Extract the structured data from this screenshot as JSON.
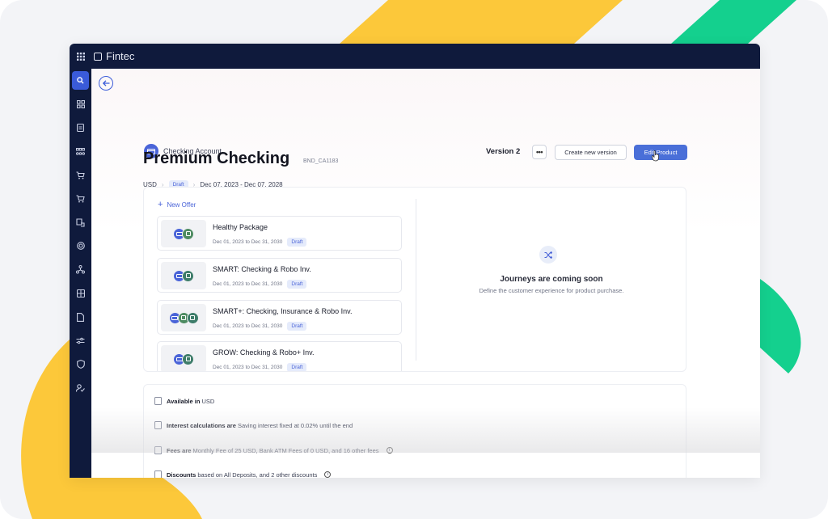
{
  "app": {
    "brand": "Fintec",
    "icons": {
      "grid": "apps-grid-icon",
      "back": "arrow-left-icon",
      "more": "more-horizontal-icon"
    }
  },
  "sidebar": {
    "items": [
      {
        "name": "search-icon",
        "active": true
      },
      {
        "name": "modules-icon"
      },
      {
        "name": "clipboard-icon"
      },
      {
        "name": "bundles-icon"
      },
      {
        "name": "cart-icon"
      },
      {
        "name": "cart-alt-icon"
      },
      {
        "name": "car-icon"
      },
      {
        "name": "target-icon"
      },
      {
        "name": "network-icon"
      },
      {
        "name": "calculator-icon"
      },
      {
        "name": "document-icon"
      },
      {
        "name": "sliders-icon"
      },
      {
        "name": "shield-icon"
      },
      {
        "name": "user-check-icon"
      }
    ]
  },
  "header": {
    "category": "Checking Account",
    "title": "Premium Checking",
    "code": "BND_CA1183",
    "currency": "USD",
    "status": "Draft",
    "date_range": "Dec 07, 2023 - Dec 07, 2028",
    "version_label": "Version 2",
    "more_label": "•••",
    "create_version_label": "Create new version",
    "edit_label": "Edit Product"
  },
  "offers": {
    "new_offer_label": "New Offer",
    "items": [
      {
        "name": "Healthy Package",
        "dates": "Dec 01, 2023 to Dec 31, 2030",
        "status": "Draft",
        "chips": [
          "blue",
          "green"
        ]
      },
      {
        "name": "SMART: Checking & Robo Inv.",
        "dates": "Dec 01, 2023 to Dec 31, 2030",
        "status": "Draft",
        "chips": [
          "blue",
          "teal"
        ]
      },
      {
        "name": "SMART+: Checking, Insurance & Robo Inv.",
        "dates": "Dec 01, 2023 to Dec 31, 2030",
        "status": "Draft",
        "chips": [
          "blue",
          "green",
          "teal"
        ]
      },
      {
        "name": "GROW: Checking & Robo+ Inv.",
        "dates": "Dec 01, 2023 to Dec 31, 2030",
        "status": "Draft",
        "chips": [
          "blue",
          "teal"
        ]
      }
    ]
  },
  "journeys": {
    "title": "Journeys are coming soon",
    "subtitle": "Define the customer experience for product purchase."
  },
  "details": {
    "rows": [
      {
        "bold": "Available in",
        "text": "USD",
        "info": false
      },
      {
        "bold": "Interest calculations are",
        "text": "Saving interest fixed at 0.02% until the end",
        "info": false
      },
      {
        "bold": "Fees are",
        "text": "Monthly Fee of 25 USD, Bank ATM Fees of 0 USD, and 16 other fees",
        "info": true
      },
      {
        "bold": "Discounts",
        "text": "based on All Deposits, and 2 other discounts",
        "info": true
      }
    ]
  },
  "colors": {
    "nav_bg": "#0f1a3c",
    "accent": "#4a6fd8",
    "decor_yellow": "#fcc83a",
    "decor_green": "#14d08e"
  }
}
